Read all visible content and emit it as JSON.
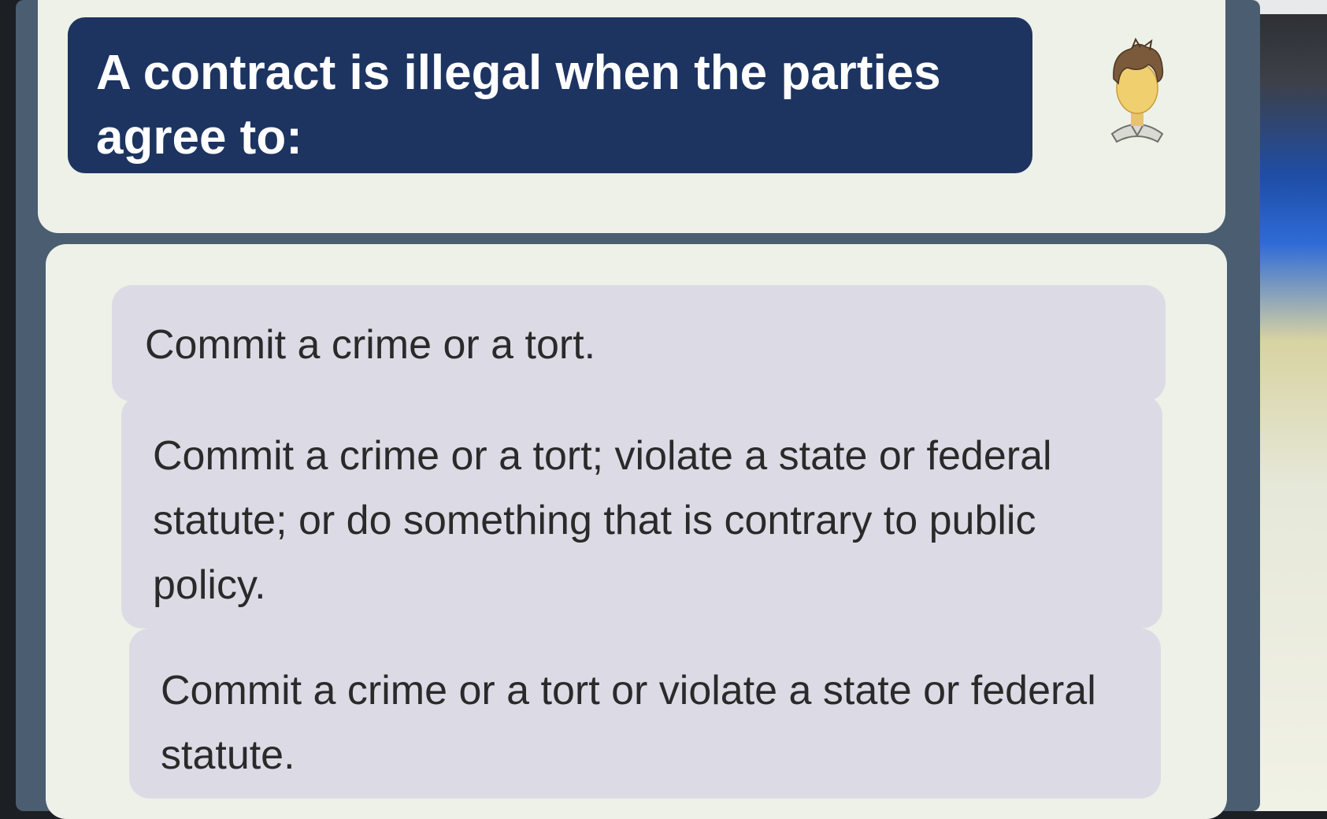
{
  "question": {
    "text": "A contract is illegal when the parties agree to:"
  },
  "avatar": {
    "icon": "student-avatar-icon"
  },
  "answers": [
    {
      "label": "Commit a crime or a tort."
    },
    {
      "label": "Commit a crime or a tort; violate a state or federal statute; or do something that is contrary to public policy."
    },
    {
      "label": "Commit a crime or a tort or violate a state or federal statute."
    }
  ],
  "colors": {
    "banner": "#1d3461",
    "card": "#eef1e8",
    "option": "#dcdbe5",
    "frame": "#4b5d70"
  }
}
